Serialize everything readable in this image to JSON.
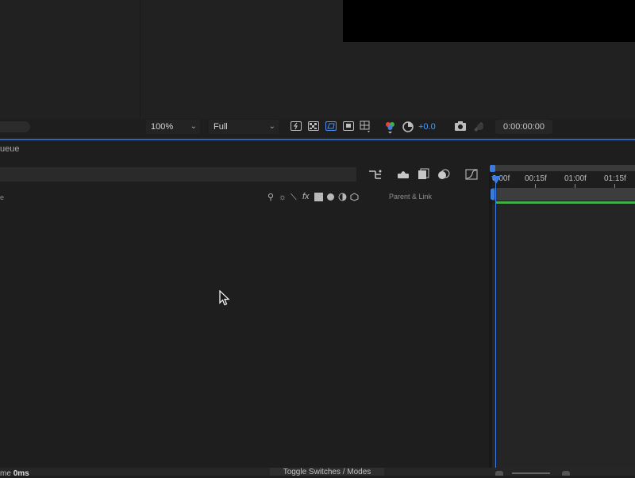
{
  "viewer": {
    "zoom_label": "100%",
    "resolution_label": "Full",
    "exposure_value": "+0.0",
    "timecode": "0:00:00:00"
  },
  "timeline": {
    "tab_label": "ueue",
    "column_name_label": "e",
    "parent_link_label": "Parent & Link",
    "ruler_labels": [
      "0:00f",
      "00:15f",
      "01:00f",
      "01:15f"
    ],
    "render_time_label": "me",
    "render_time_value": "0ms",
    "toggle_switches_label": "Toggle Switches / Modes"
  },
  "colors": {
    "accent_blue": "#3a7ee6",
    "layer_bar_green": "#3fae4b"
  },
  "icons": {
    "switch_icons": [
      "shy-icon",
      "solo-icon",
      "quality-icon",
      "fx-icon",
      "frame-blend-icon",
      "motion-blur-icon",
      "adjustment-icon",
      "3d-layer-icon"
    ]
  }
}
